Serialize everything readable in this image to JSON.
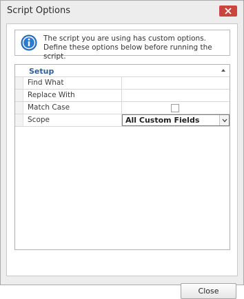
{
  "window": {
    "title": "Script Options"
  },
  "info": {
    "message": "The script you are using has custom options. Define these options below before running the script."
  },
  "grid": {
    "category": "Setup",
    "rows": [
      {
        "label": "Find What",
        "value": ""
      },
      {
        "label": "Replace With",
        "value": ""
      },
      {
        "label": "Match Case",
        "value": "",
        "checked": false
      },
      {
        "label": "Scope",
        "value": "All Custom Fields"
      }
    ]
  },
  "footer": {
    "close_label": "Close"
  },
  "colors": {
    "close_x_bg": "#c9463d",
    "info_icon": "#2d7ad1",
    "category_text": "#2f5d9a"
  }
}
